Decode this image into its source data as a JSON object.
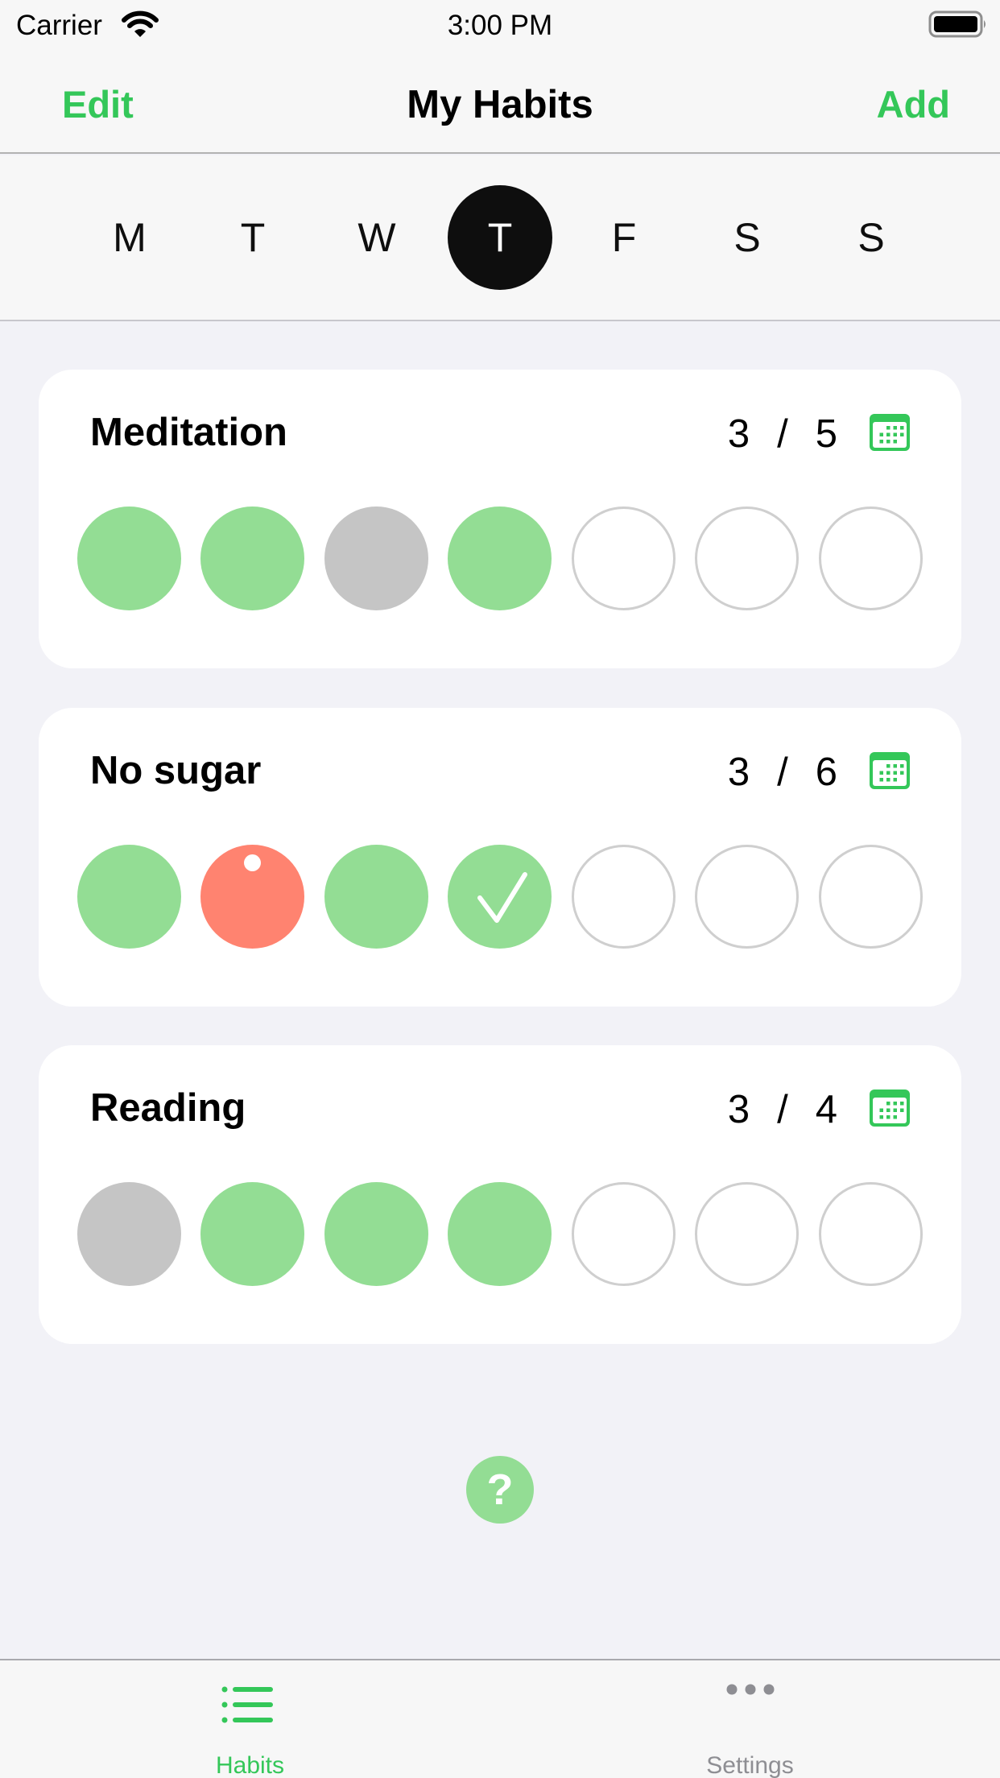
{
  "status_bar": {
    "carrier": "Carrier",
    "time": "3:00 PM"
  },
  "nav": {
    "edit_label": "Edit",
    "title": "My Habits",
    "add_label": "Add"
  },
  "colors": {
    "accent": "#34C759",
    "done": "#93DD94",
    "skipped": "#C5C5C5",
    "failed": "#FF8370",
    "empty_border": "#CFCFCF",
    "selected_day": "#0E0E0E"
  },
  "week": {
    "days": [
      "M",
      "T",
      "W",
      "T",
      "F",
      "S",
      "S"
    ],
    "selected_index": 3
  },
  "habits": [
    {
      "name": "Meditation",
      "done": "3",
      "separator": "/",
      "goal": "5",
      "days": [
        "done",
        "done",
        "skipped",
        "done",
        "empty",
        "empty",
        "empty"
      ]
    },
    {
      "name": "No sugar",
      "done": "3",
      "separator": "/",
      "goal": "6",
      "days": [
        "done",
        "failed-with-note",
        "done",
        "done-today-check",
        "empty",
        "empty",
        "empty"
      ]
    },
    {
      "name": "Reading",
      "done": "3",
      "separator": "/",
      "goal": "4",
      "days": [
        "skipped",
        "done",
        "done",
        "done",
        "empty",
        "empty",
        "empty"
      ]
    }
  ],
  "help": {
    "icon": "question-mark-icon",
    "label": "?"
  },
  "tabs": [
    {
      "label": "Habits",
      "icon": "list-bullet-icon",
      "active": true
    },
    {
      "label": "Settings",
      "icon": "more-dots-icon",
      "active": false
    }
  ]
}
